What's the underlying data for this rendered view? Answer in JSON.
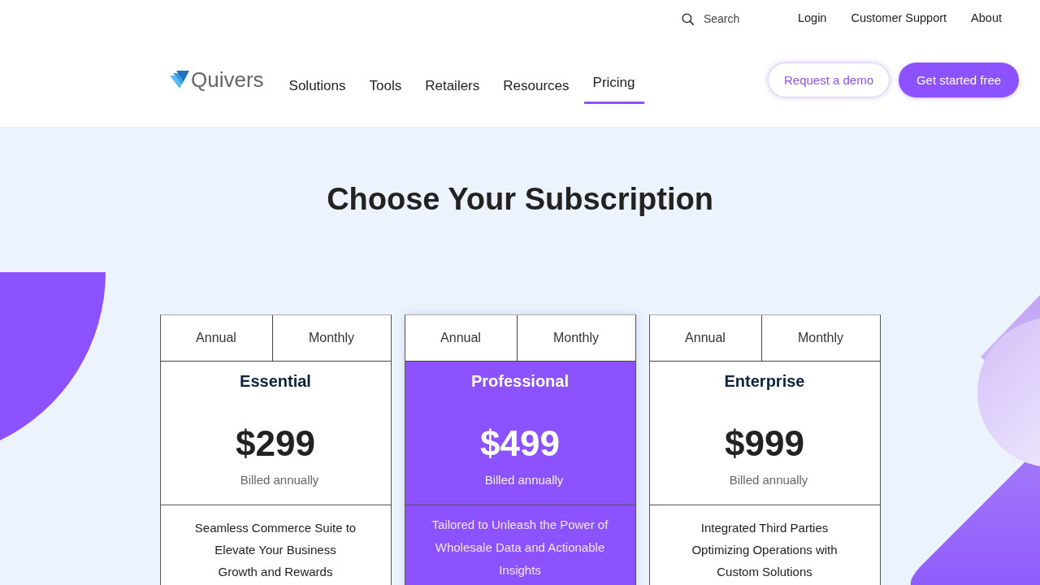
{
  "top_bar": {
    "search": {
      "placeholder": "Search"
    },
    "links": [
      "Login",
      "Customer Support",
      "About"
    ]
  },
  "header": {
    "logo": {
      "name": "Quivers"
    },
    "nav": [
      {
        "label": "Solutions",
        "selected": false
      },
      {
        "label": "Tools",
        "selected": false
      },
      {
        "label": "Retailers",
        "selected": false
      },
      {
        "label": "Resources",
        "selected": false
      },
      {
        "label": "Pricing",
        "selected": true
      }
    ],
    "buttons": [
      {
        "label": "Request a demo",
        "kind": "outline"
      },
      {
        "label": "Get started free",
        "kind": "filled"
      }
    ]
  },
  "heading": "Choose Your Subscription",
  "plans": [
    {
      "billing_options": [
        "Annual",
        "Monthly"
      ],
      "name": "Essential",
      "price": "$299",
      "billing_note": "Billed annually",
      "description": "Seamless Commerce Suite to Elevate Your Business Growth and Rewards",
      "highlighted": false
    },
    {
      "billing_options": [
        "Annual",
        "Monthly"
      ],
      "name": "Professional",
      "price": "$499",
      "billing_note": "Billed annually",
      "description": "Tailored to Unleash the Power of Wholesale Data and Actionable Insights",
      "highlighted": true
    },
    {
      "billing_options": [
        "Annual",
        "Monthly"
      ],
      "name": "Enterprise",
      "price": "$999",
      "billing_note": "Billed annually",
      "description": "Integrated Third Parties Optimizing Operations with Custom Solutions",
      "highlighted": false
    }
  ]
}
